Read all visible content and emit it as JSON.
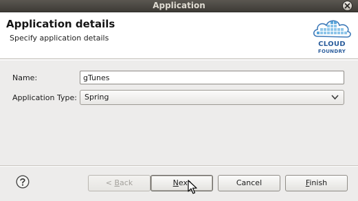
{
  "window": {
    "title": "Application"
  },
  "header": {
    "title": "Application details",
    "subtitle": "Specify application details",
    "logo": {
      "line1": "CLOUD",
      "line2": "FOUNDRY"
    }
  },
  "form": {
    "name_label": "Name:",
    "name_value": "gTunes",
    "type_label": "Application Type:",
    "type_value": "Spring"
  },
  "buttons": {
    "back": {
      "prefix": "< ",
      "mnemonic": "B",
      "rest": "ack"
    },
    "next": {
      "mnemonic": "N",
      "rest": "ext"
    },
    "cancel": {
      "label": "Cancel"
    },
    "finish": {
      "mnemonic": "F",
      "rest": "inish"
    }
  },
  "icons": {
    "close": "close-icon",
    "help": "help-icon",
    "dropdown": "chevron-down-icon",
    "logo": "cloud-foundry-logo"
  },
  "colors": {
    "titlebar": "#4a4741",
    "logo_blue": "#2b5d9c",
    "logo_light": "#8fc6ea"
  }
}
